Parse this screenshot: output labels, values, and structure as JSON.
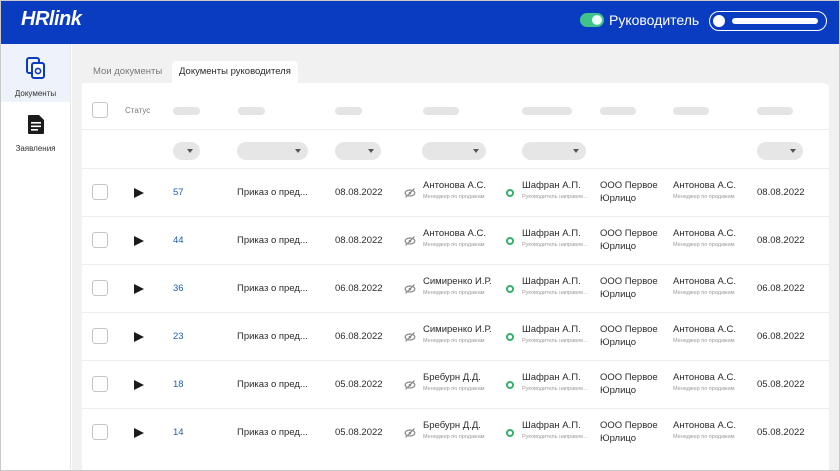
{
  "header": {
    "logo": "HRlink",
    "role_label": "Руководитель",
    "toggle_on": true
  },
  "sidebar": {
    "items": [
      {
        "label": "Документы",
        "icon": "documents-icon",
        "active": true
      },
      {
        "label": "Заявления",
        "icon": "application-icon",
        "active": false
      }
    ]
  },
  "tabs": [
    {
      "label": "Мои документы",
      "active": false
    },
    {
      "label": "Документы руководителя",
      "active": true
    }
  ],
  "table": {
    "status_header": "Статус",
    "rows": [
      {
        "number": "57",
        "title": "Приказ о пред...",
        "date": "08.08.2022",
        "signer_name": "Антонова А.С.",
        "signer_role": "Менеджер по продажам",
        "manager_name": "Шафран А.П.",
        "manager_role": "Руководитель направле...",
        "company_line1": "ООО Первое",
        "company_line2": "Юрлицо",
        "employee_name": "Антонова А.С.",
        "employee_role": "Менеджер по продажам",
        "date2": "08.08.2022"
      },
      {
        "number": "44",
        "title": "Приказ о пред...",
        "date": "08.08.2022",
        "signer_name": "Антонова А.С.",
        "signer_role": "Менеджер по продажам",
        "manager_name": "Шафран А.П.",
        "manager_role": "Руководитель направле...",
        "company_line1": "ООО Первое",
        "company_line2": "Юрлицо",
        "employee_name": "Антонова А.С.",
        "employee_role": "Менеджер по продажам",
        "date2": "08.08.2022"
      },
      {
        "number": "36",
        "title": "Приказ о пред...",
        "date": "06.08.2022",
        "signer_name": "Симиренко И.Р.",
        "signer_role": "Менеджер по продажам",
        "manager_name": "Шафран А.П.",
        "manager_role": "Руководитель направле...",
        "company_line1": "ООО Первое",
        "company_line2": "Юрлицо",
        "employee_name": "Антонова А.С.",
        "employee_role": "Менеджер по продажам",
        "date2": "06.08.2022"
      },
      {
        "number": "23",
        "title": "Приказ о пред...",
        "date": "06.08.2022",
        "signer_name": "Симиренко И.Р.",
        "signer_role": "Менеджер по продажам",
        "manager_name": "Шафран А.П.",
        "manager_role": "Руководитель направле...",
        "company_line1": "ООО Первое",
        "company_line2": "Юрлицо",
        "employee_name": "Антонова А.С.",
        "employee_role": "Менеджер по продажам",
        "date2": "06.08.2022"
      },
      {
        "number": "18",
        "title": "Приказ о пред...",
        "date": "05.08.2022",
        "signer_name": "Бребурн Д.Д.",
        "signer_role": "Менеджер по продажам",
        "manager_name": "Шафран А.П.",
        "manager_role": "Руководитель направле...",
        "company_line1": "ООО Первое",
        "company_line2": "Юрлицо",
        "employee_name": "Антонова А.С.",
        "employee_role": "Менеджер по продажам",
        "date2": "05.08.2022"
      },
      {
        "number": "14",
        "title": "Приказ о пред...",
        "date": "05.08.2022",
        "signer_name": "Бребурн Д.Д.",
        "signer_role": "Менеджер по продажам",
        "manager_name": "Шафран А.П.",
        "manager_role": "Руководитель направле...",
        "company_line1": "ООО Первое",
        "company_line2": "Юрлицо",
        "employee_name": "Антонова А.С.",
        "employee_role": "Менеджер по продажам",
        "date2": "05.08.2022"
      }
    ]
  },
  "colors": {
    "header_bg": "#0a3cc2",
    "toggle": "#3fc38a",
    "link": "#1f5fae",
    "status_green": "#35b26e"
  }
}
